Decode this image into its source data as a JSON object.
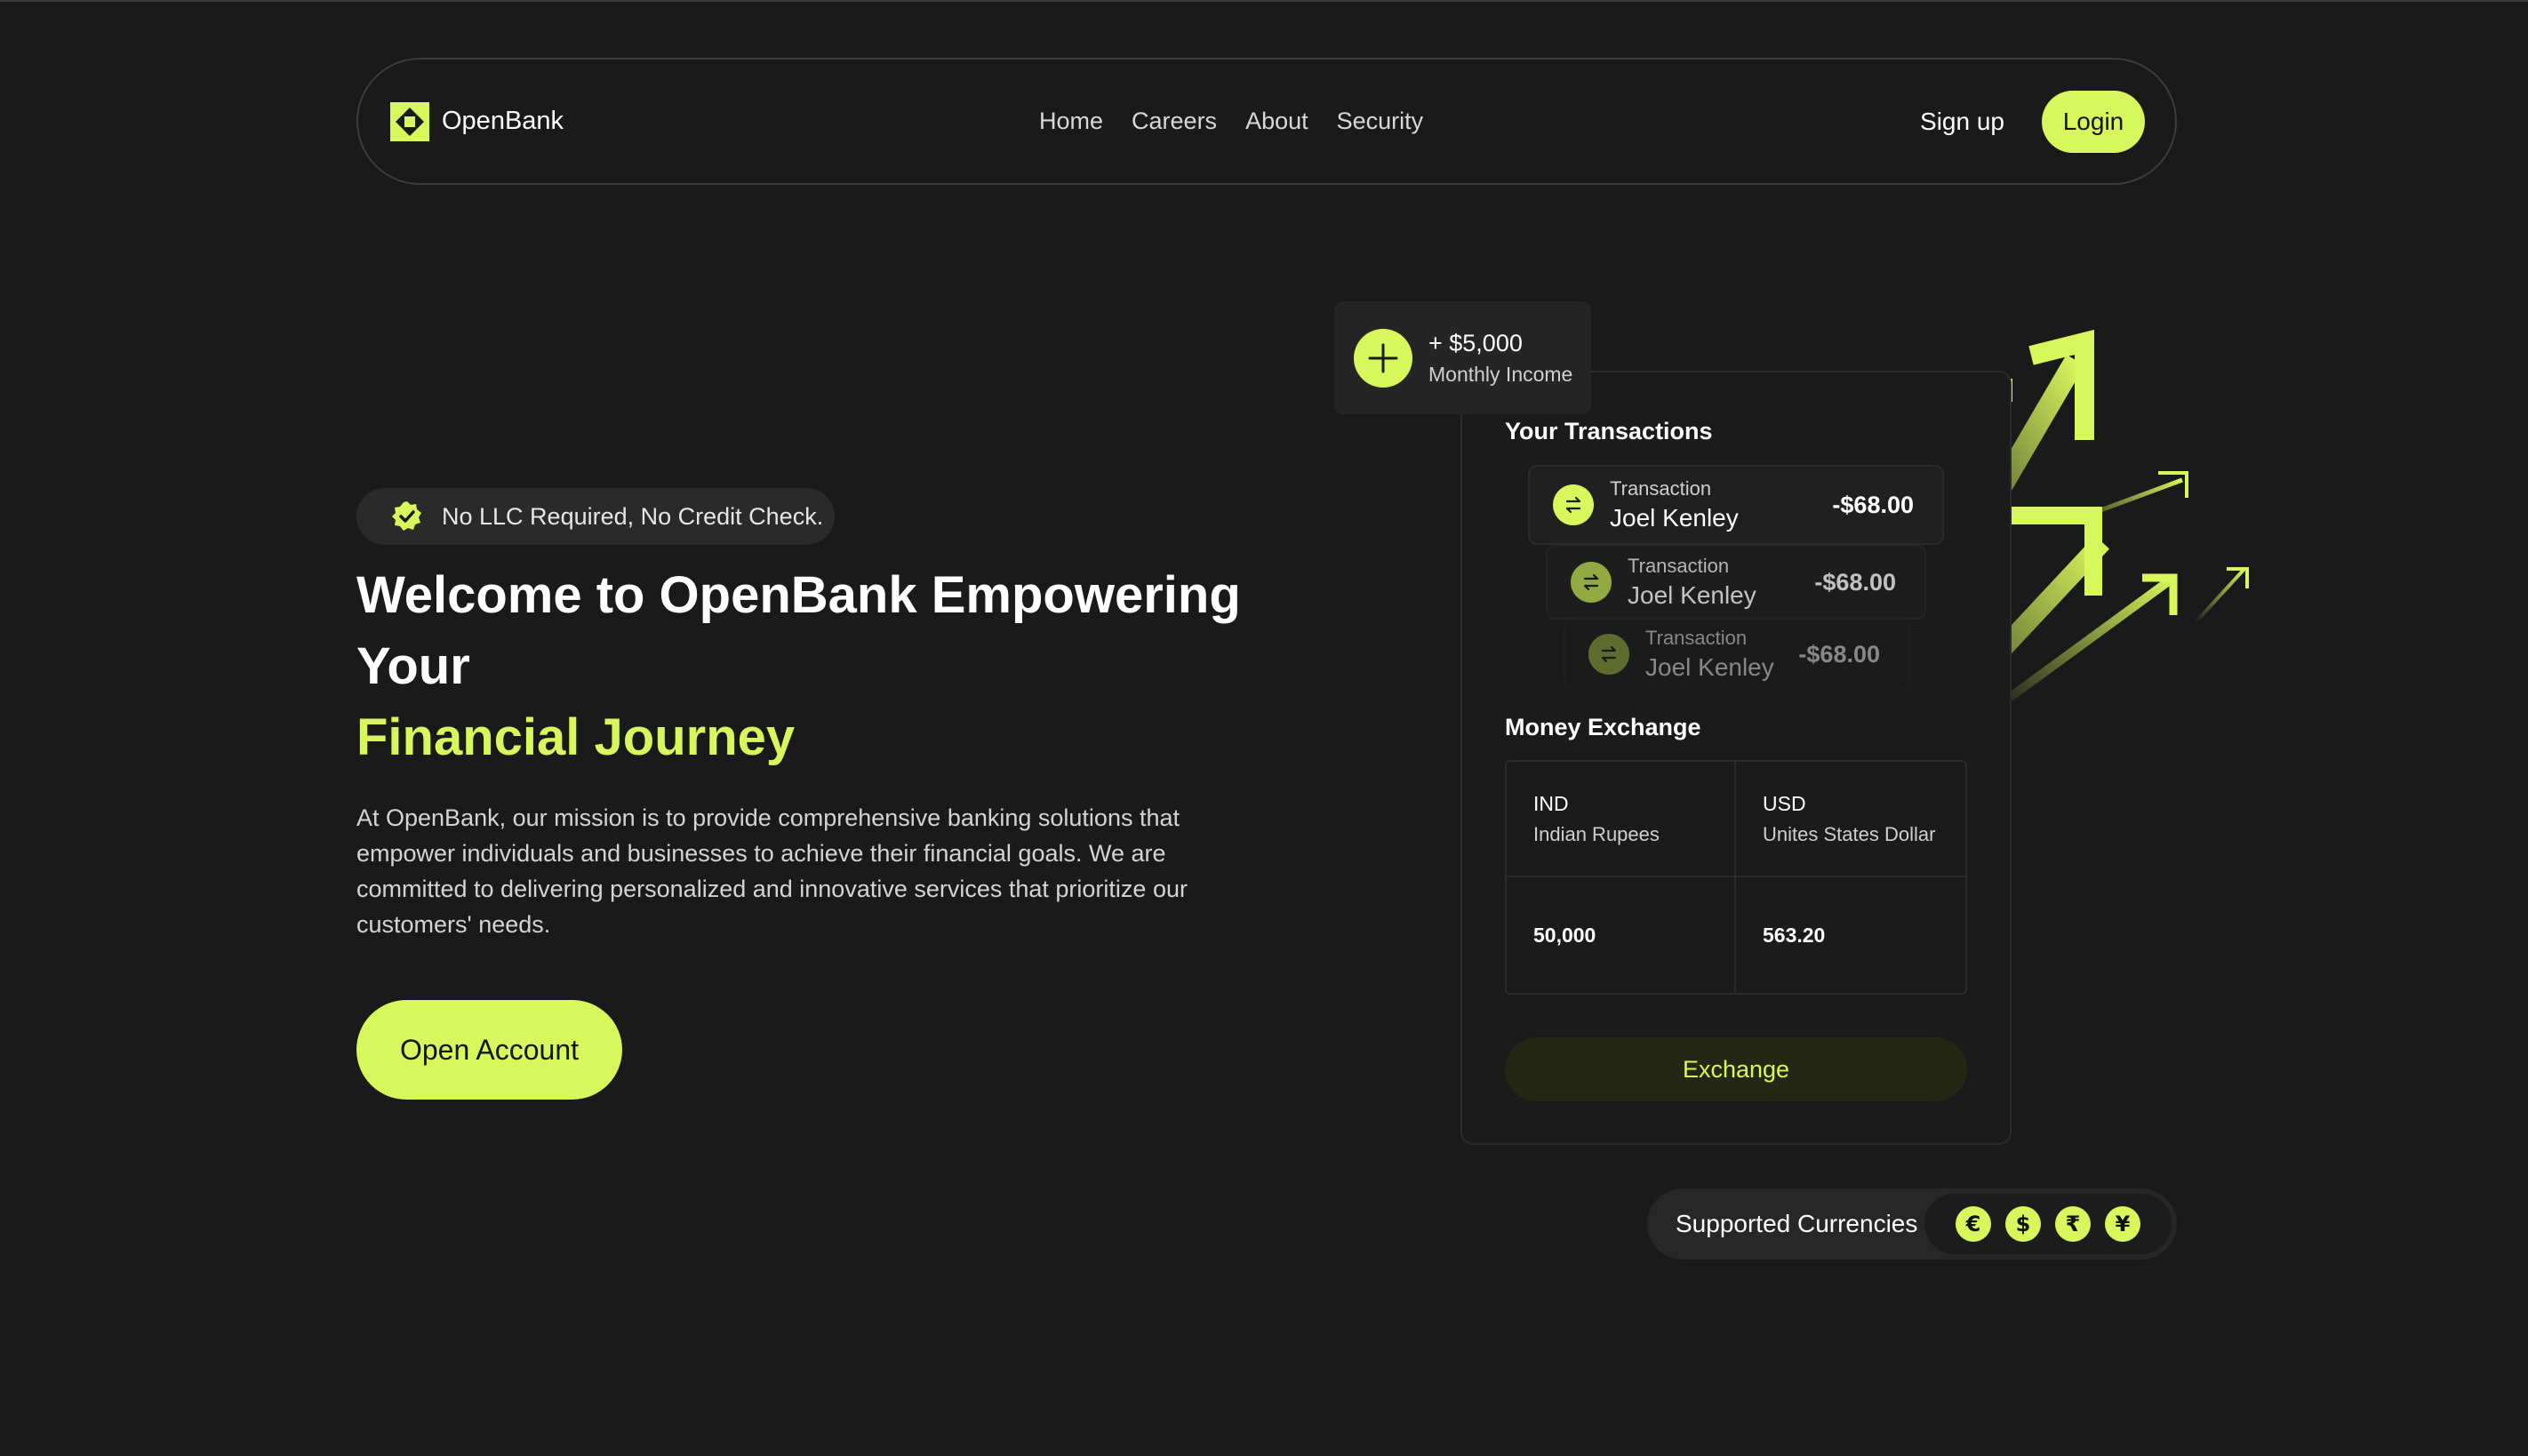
{
  "nav": {
    "brand": "OpenBank",
    "links": [
      "Home",
      "Careers",
      "About",
      "Security"
    ],
    "signup": "Sign up",
    "login": "Login"
  },
  "hero": {
    "badge": "No LLC Required, No Credit Check.",
    "title_line1": "Welcome to OpenBank Empowering Your",
    "title_accent": "Financial Journey",
    "description": "At OpenBank, our mission is to provide comprehensive banking solutions that empower individuals and businesses to achieve their financial goals. We are committed to delivering personalized and innovative services that prioritize our customers' needs.",
    "cta": "Open Account"
  },
  "income": {
    "amount": "+ $5,000",
    "label": "Monthly Income"
  },
  "transactions": {
    "title": "Your Transactions",
    "items": [
      {
        "label": "Transaction",
        "name": "Joel Kenley",
        "amount": "-$68.00"
      },
      {
        "label": "Transaction",
        "name": "Joel Kenley",
        "amount": "-$68.00"
      },
      {
        "label": "Transaction",
        "name": "Joel Kenley",
        "amount": "-$68.00"
      }
    ]
  },
  "exchange": {
    "title": "Money Exchange",
    "from_code": "IND",
    "from_name": "Indian Rupees",
    "to_code": "USD",
    "to_name": "Unites States Dollar",
    "from_value": "50,000",
    "to_value": "563.20",
    "button": "Exchange"
  },
  "currencies": {
    "label": "Supported Currencies",
    "symbols": [
      "€",
      "$",
      "₹",
      "¥"
    ]
  },
  "colors": {
    "accent": "#d8f75c",
    "background": "#1a1a1a"
  }
}
